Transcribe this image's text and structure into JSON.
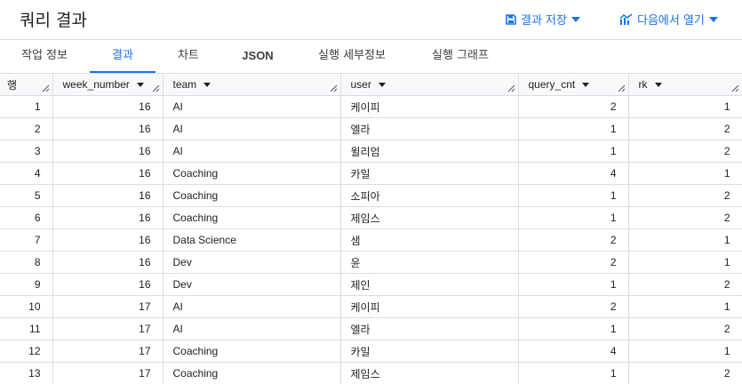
{
  "header": {
    "title": "쿼리 결과",
    "save_label": "결과 저장",
    "open_label": "다음에서 열기"
  },
  "tabs": [
    {
      "label": "작업 정보"
    },
    {
      "label": "결과"
    },
    {
      "label": "차트"
    },
    {
      "label": "JSON"
    },
    {
      "label": "실행 세부정보"
    },
    {
      "label": "실행 그래프"
    }
  ],
  "active_tab": "결과",
  "accent_color": "#1a73e8",
  "table": {
    "index_header": "행",
    "columns": [
      "week_number",
      "team",
      "user",
      "query_cnt",
      "rk"
    ],
    "rows": [
      {
        "row": "1",
        "week_number": "16",
        "team": "AI",
        "user": "케이피",
        "query_cnt": "2",
        "rk": "1"
      },
      {
        "row": "2",
        "week_number": "16",
        "team": "AI",
        "user": "엘라",
        "query_cnt": "1",
        "rk": "2"
      },
      {
        "row": "3",
        "week_number": "16",
        "team": "AI",
        "user": "윌리엄",
        "query_cnt": "1",
        "rk": "2"
      },
      {
        "row": "4",
        "week_number": "16",
        "team": "Coaching",
        "user": "카일",
        "query_cnt": "4",
        "rk": "1"
      },
      {
        "row": "5",
        "week_number": "16",
        "team": "Coaching",
        "user": "소피아",
        "query_cnt": "1",
        "rk": "2"
      },
      {
        "row": "6",
        "week_number": "16",
        "team": "Coaching",
        "user": "제임스",
        "query_cnt": "1",
        "rk": "2"
      },
      {
        "row": "7",
        "week_number": "16",
        "team": "Data Science",
        "user": "샘",
        "query_cnt": "2",
        "rk": "1"
      },
      {
        "row": "8",
        "week_number": "16",
        "team": "Dev",
        "user": "윤",
        "query_cnt": "2",
        "rk": "1"
      },
      {
        "row": "9",
        "week_number": "16",
        "team": "Dev",
        "user": "제인",
        "query_cnt": "1",
        "rk": "2"
      },
      {
        "row": "10",
        "week_number": "17",
        "team": "AI",
        "user": "케이피",
        "query_cnt": "2",
        "rk": "1"
      },
      {
        "row": "11",
        "week_number": "17",
        "team": "AI",
        "user": "엘라",
        "query_cnt": "1",
        "rk": "2"
      },
      {
        "row": "12",
        "week_number": "17",
        "team": "Coaching",
        "user": "카일",
        "query_cnt": "4",
        "rk": "1"
      },
      {
        "row": "13",
        "week_number": "17",
        "team": "Coaching",
        "user": "제임스",
        "query_cnt": "1",
        "rk": "2"
      }
    ]
  }
}
